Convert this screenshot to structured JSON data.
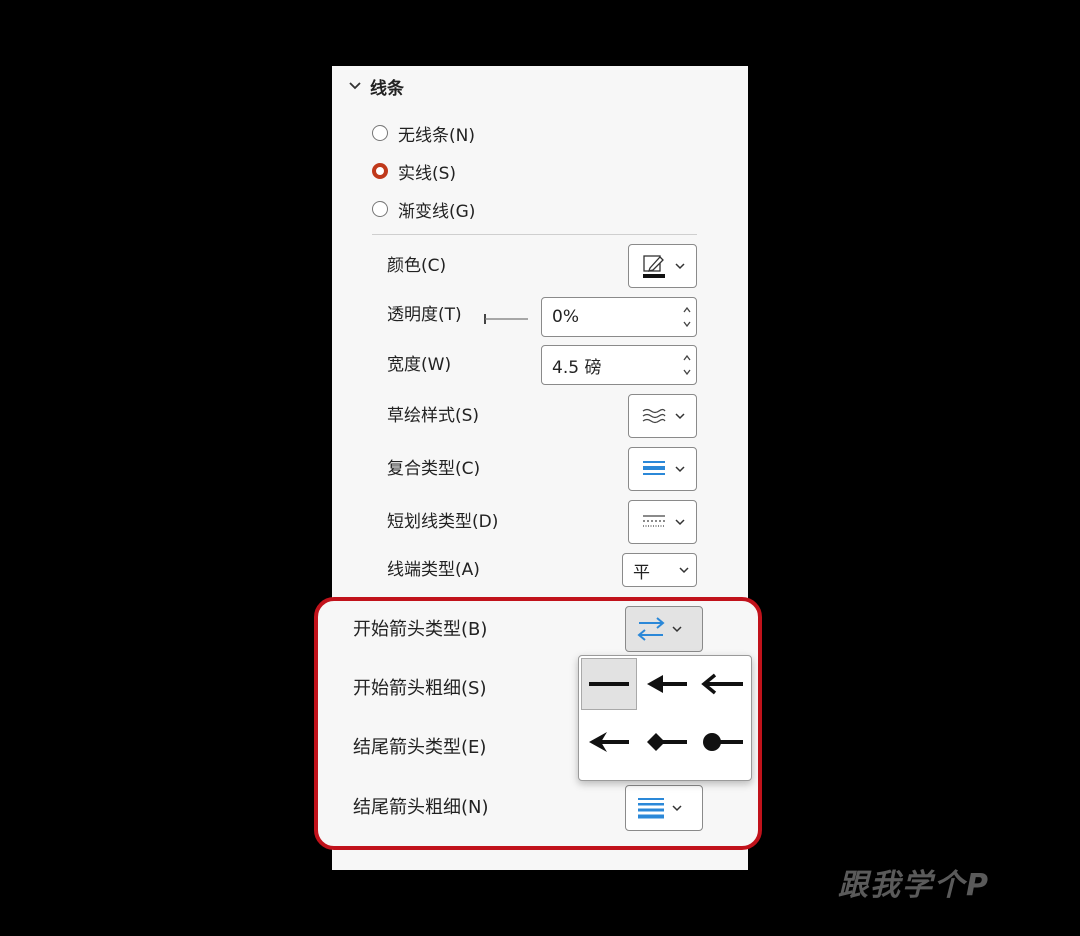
{
  "section": {
    "title": "线条"
  },
  "line_options": [
    {
      "label": "无线条(N)",
      "selected": false
    },
    {
      "label": "实线(S)",
      "selected": true
    },
    {
      "label": "渐变线(G)",
      "selected": false
    }
  ],
  "props": {
    "color_label": "颜色(C)",
    "transparency_label": "透明度(T)",
    "transparency_value": "0%",
    "width_label": "宽度(W)",
    "width_value": "4.5 磅",
    "sketch_label": "草绘样式(S)",
    "compound_label": "复合类型(C)",
    "dash_label": "短划线类型(D)",
    "cap_label": "线端类型(A)",
    "cap_value": "平"
  },
  "arrows": {
    "begin_type_label": "开始箭头类型(B)",
    "begin_size_label": "开始箭头粗细(S)",
    "end_type_label": "结尾箭头类型(E)",
    "end_size_label": "结尾箭头粗细(N)"
  },
  "flyout_items": [
    "no-arrow",
    "triangle-arrow",
    "open-arrow",
    "stealth-arrow",
    "diamond-arrow",
    "oval-arrow"
  ],
  "colors": {
    "accent": "#c0391b",
    "highlight_border": "#c1121b",
    "icon_blue": "#2b88d8"
  },
  "watermark": "跟我学个P"
}
